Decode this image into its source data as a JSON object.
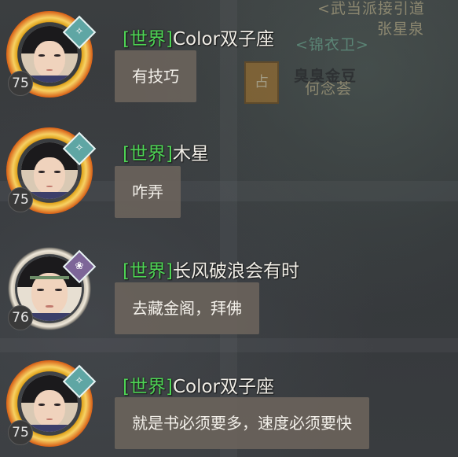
{
  "map": {
    "labels": [
      "<武当派接引道",
      "<锦衣卫>",
      "张星泉",
      "臭臭金豆",
      "何念荟"
    ],
    "badge": "占"
  },
  "chat": {
    "messages": [
      {
        "level": "75",
        "channel": "[世界]",
        "name": "Color双子座",
        "text": "有技巧",
        "avatar_frame": "gold",
        "sect_icon": "sect-emblem-icon"
      },
      {
        "level": "75",
        "channel": "[世界]",
        "name": "木星",
        "text": "咋弄",
        "avatar_frame": "gold",
        "sect_icon": "sect-emblem-icon"
      },
      {
        "level": "76",
        "channel": "[世界]",
        "name": "长风破浪会有时",
        "text": "去藏金阁，拜佛",
        "avatar_frame": "plain",
        "sect_icon": "sect-emblem-icon"
      },
      {
        "level": "75",
        "channel": "[世界]",
        "name": "Color双子座",
        "text": "就是书必须要多，速度必须要快",
        "avatar_frame": "gold",
        "sect_icon": "sect-emblem-icon"
      }
    ]
  },
  "colors": {
    "channel": "#4ed455",
    "name": "#f0ede6",
    "bubble": "#6c645c",
    "background": "#3a3d40"
  }
}
